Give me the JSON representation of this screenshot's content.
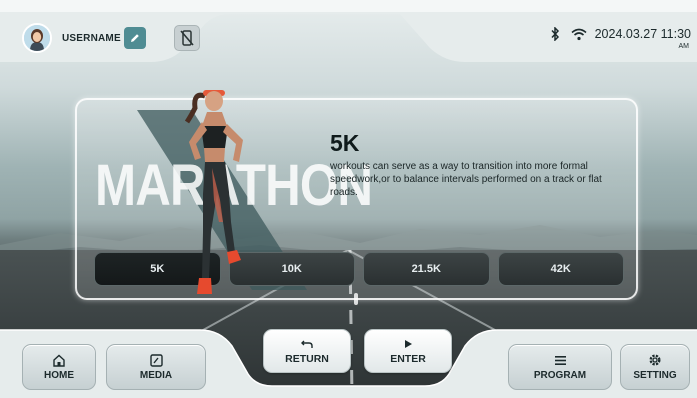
{
  "header": {
    "username": "USERNAME",
    "icons": [
      "avatar",
      "edit-icon",
      "phone-off-icon",
      "bluetooth-icon",
      "wifi-icon"
    ],
    "datetime": "2024.03.27 11:30",
    "ampm": "AM"
  },
  "hero": {
    "background_word": "MARATHON",
    "selected_title": "5K",
    "description": "workouts can serve as a way to transition into more formal speedwork,or to balance intervals performed on a track or flat roads."
  },
  "distances": {
    "options": [
      "5K",
      "10K",
      "21.5K",
      "42K"
    ],
    "selected": "5K"
  },
  "footer": {
    "home_label": "HOME",
    "media_label": "MEDIA",
    "return_label": "RETURN",
    "enter_label": "ENTER",
    "program_label": "PROGRAM",
    "setting_label": "SETTING"
  },
  "colors": {
    "accent": "#4f8c93",
    "button_dark": "#2a3031",
    "text_dark": "#1c2a2c"
  }
}
